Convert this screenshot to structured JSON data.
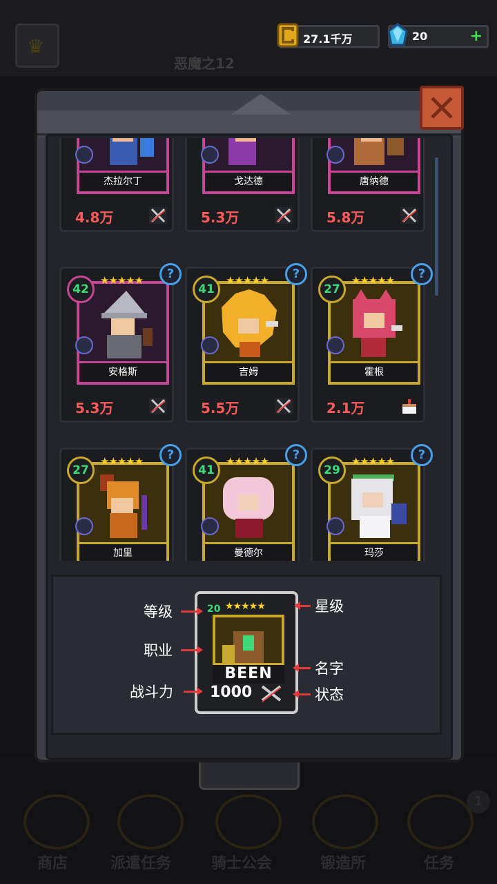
{
  "currency": {
    "gold": "27.1千万",
    "gems": "20"
  },
  "background": {
    "stage": "恶魔之12",
    "nav": [
      "商店",
      "派遣任务",
      "骑士公会",
      "锻造所",
      "任务"
    ],
    "badge": "1"
  },
  "heroes": [
    {
      "name": "杰拉尔丁",
      "power": "4.8万",
      "rarity": "epic",
      "status": "swords-crossed"
    },
    {
      "name": "戈达德",
      "power": "5.3万",
      "rarity": "epic",
      "status": "swords-crossed"
    },
    {
      "name": "唐纳德",
      "power": "5.8万",
      "rarity": "epic",
      "status": "swords-crossed"
    },
    {
      "name": "安格斯",
      "level": "42",
      "stars": "★★★★★",
      "power": "5.3万",
      "rarity": "epic",
      "status": "swords-crossed"
    },
    {
      "name": "吉姆",
      "level": "41",
      "stars": "★★★★★",
      "power": "5.5万",
      "rarity": "legendary",
      "status": "swords-crossed"
    },
    {
      "name": "霍根",
      "level": "27",
      "stars": "★★★★★",
      "power": "2.1万",
      "rarity": "legendary",
      "status": "cake"
    },
    {
      "name": "加里",
      "level": "27",
      "stars": "★★★★★",
      "rarity": "legendary"
    },
    {
      "name": "曼德尔",
      "level": "41",
      "stars": "★★★★★",
      "rarity": "legendary"
    },
    {
      "name": "玛莎",
      "level": "29",
      "stars": "★★★★★",
      "rarity": "legendary"
    }
  ],
  "legend": {
    "card_level": "20",
    "card_stars": "★★★★★",
    "card_name": "BEEN",
    "card_power": "1000",
    "labels": {
      "level": "等级",
      "class": "职业",
      "power": "战斗力",
      "stars": "星级",
      "name": "名字",
      "status": "状态"
    }
  },
  "colors": {
    "epic_frame": "#c84494",
    "legendary_frame": "#c9a92c",
    "power_text": "#ff5a5a",
    "level_text": "#3ed878",
    "close_button": "#c65a36"
  }
}
